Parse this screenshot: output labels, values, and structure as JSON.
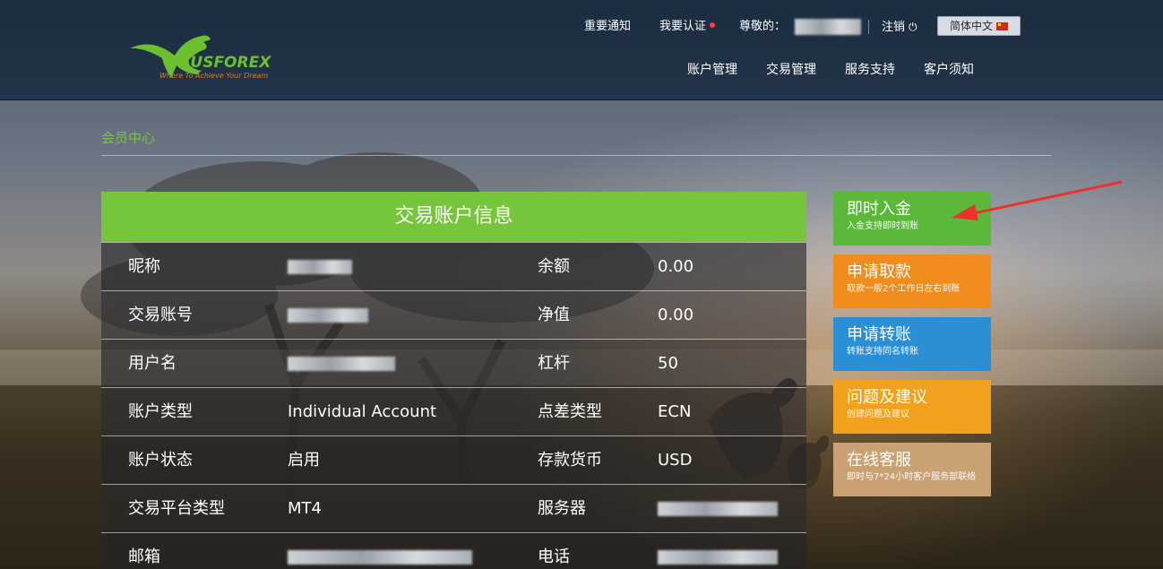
{
  "header": {
    "logo_text": "AUSFOREX",
    "logo_slogan": "Where To Achieve Your Dream",
    "util": {
      "notice": "重要通知",
      "verify": "我要认证",
      "greeting": "尊敬的：",
      "logout": "注销",
      "language": "简体中文"
    },
    "nav": [
      "账户管理",
      "交易管理",
      "服务支持",
      "客户须知"
    ]
  },
  "breadcrumb": "会员中心",
  "account_panel": {
    "title": "交易账户信息",
    "rows": [
      {
        "label1": "昵称",
        "value1": "",
        "label2": "余额",
        "value2": "0.00"
      },
      {
        "label1": "交易账号",
        "value1": "",
        "label2": "净值",
        "value2": "0.00"
      },
      {
        "label1": "用户名",
        "value1": "",
        "label2": "杠杆",
        "value2": "50"
      },
      {
        "label1": "账户类型",
        "value1": "Individual Account",
        "label2": "点差类型",
        "value2": "ECN"
      },
      {
        "label1": "账户状态",
        "value1": "启用",
        "label2": "存款货币",
        "value2": "USD"
      },
      {
        "label1": "交易平台类型",
        "value1": "MT4",
        "label2": "服务器",
        "value2": ""
      },
      {
        "label1": "邮箱",
        "value1": "",
        "label2": "电话",
        "value2": ""
      }
    ]
  },
  "side_buttons": [
    {
      "title": "即时入金",
      "subtitle": "入金支持即时到账",
      "color": "#5cb83b"
    },
    {
      "title": "申请取款",
      "subtitle": "取款一般2个工作日左右到账",
      "color": "#f08d1d"
    },
    {
      "title": "申请转账",
      "subtitle": "转账支持同名转账",
      "color": "#2b8fd6"
    },
    {
      "title": "问题及建议",
      "subtitle": "创建问题及建议",
      "color": "#f2a11e"
    },
    {
      "title": "在线客服",
      "subtitle": "即时与7*24小时客户服务部联络",
      "color": "#c9a173"
    }
  ],
  "colors": {
    "accent_green": "#76c63b",
    "header_bg": "#1b2c40",
    "annotation_arrow": "#e8342c"
  }
}
